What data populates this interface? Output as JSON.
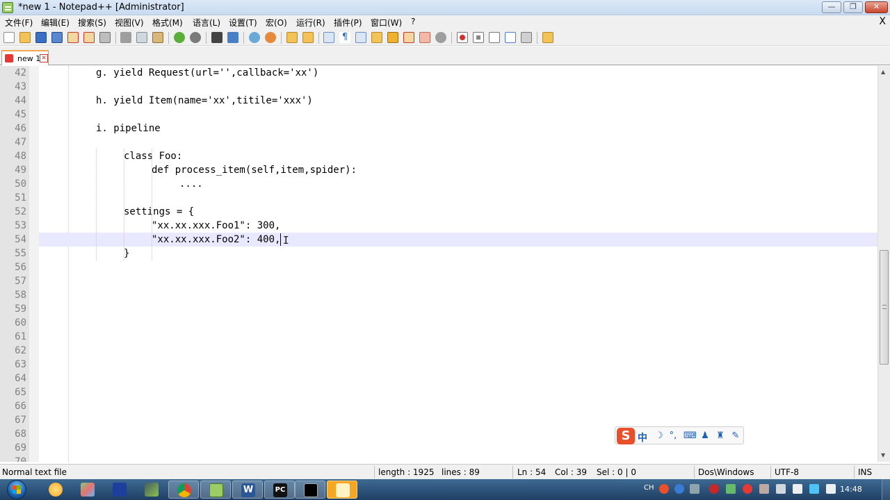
{
  "window": {
    "title": "*new 1 - Notepad++ [Administrator]",
    "minimize_glyph": "—",
    "restore_glyph": "❐",
    "close_glyph": "✕"
  },
  "menu": {
    "items": [
      "文件(F)",
      "编辑(E)",
      "搜索(S)",
      "视图(V)",
      "格式(M)",
      "语言(L)",
      "设置(T)",
      "宏(O)",
      "运行(R)",
      "插件(P)",
      "窗口(W)",
      "?"
    ],
    "close_doc": "X"
  },
  "toolbar": {
    "icons": [
      "new-file-icon",
      "open-file-icon",
      "save-icon",
      "save-all-icon",
      "close-icon",
      "close-all-icon",
      "print-icon",
      "cut-icon",
      "copy-icon",
      "paste-icon",
      "undo-icon",
      "redo-icon",
      "find-icon",
      "replace-icon",
      "zoom-in-icon",
      "zoom-out-icon",
      "sync-vertical-icon",
      "sync-horizontal-icon",
      "word-wrap-icon",
      "show-all-chars-icon",
      "indent-guide-icon",
      "user-lang-icon",
      "doc-map-icon",
      "function-list-icon",
      "folder-workspace-icon",
      "monitoring-icon",
      "record-macro-icon",
      "stop-record-icon",
      "play-macro-icon",
      "run-macro-multiple-icon",
      "save-macro-icon",
      "plugin-icon"
    ]
  },
  "tabs": [
    {
      "label": "new 1",
      "modified": true
    }
  ],
  "editor": {
    "lines": [
      {
        "num": "42",
        "indent": 2,
        "text": "g. yield Request(url='',callback='xx')"
      },
      {
        "num": "43",
        "indent": 0,
        "text": ""
      },
      {
        "num": "44",
        "indent": 2,
        "text": "h. yield Item(name='xx',titile='xxx')"
      },
      {
        "num": "45",
        "indent": 0,
        "text": ""
      },
      {
        "num": "46",
        "indent": 2,
        "text": "i. pipeline"
      },
      {
        "num": "47",
        "indent": 0,
        "text": ""
      },
      {
        "num": "48",
        "indent": 3,
        "text": "class Foo:"
      },
      {
        "num": "49",
        "indent": 4,
        "text": "def process_item(self,item,spider):"
      },
      {
        "num": "50",
        "indent": 5,
        "text": "...."
      },
      {
        "num": "51",
        "indent": 0,
        "text": ""
      },
      {
        "num": "52",
        "indent": 3,
        "text": "settings = {"
      },
      {
        "num": "53",
        "indent": 4,
        "text": "\"xx.xx.xxx.Foo1\": 300,"
      },
      {
        "num": "54",
        "indent": 4,
        "text": "\"xx.xx.xxx.Foo2\": 400,"
      },
      {
        "num": "55",
        "indent": 3,
        "text": "}"
      },
      {
        "num": "56",
        "indent": 0,
        "text": ""
      },
      {
        "num": "57",
        "indent": 0,
        "text": ""
      },
      {
        "num": "58",
        "indent": 0,
        "text": ""
      },
      {
        "num": "59",
        "indent": 0,
        "text": ""
      },
      {
        "num": "60",
        "indent": 0,
        "text": ""
      },
      {
        "num": "61",
        "indent": 0,
        "text": ""
      },
      {
        "num": "62",
        "indent": 0,
        "text": ""
      },
      {
        "num": "63",
        "indent": 0,
        "text": ""
      },
      {
        "num": "64",
        "indent": 0,
        "text": ""
      },
      {
        "num": "65",
        "indent": 0,
        "text": ""
      },
      {
        "num": "66",
        "indent": 0,
        "text": ""
      },
      {
        "num": "67",
        "indent": 0,
        "text": ""
      },
      {
        "num": "68",
        "indent": 0,
        "text": ""
      },
      {
        "num": "69",
        "indent": 0,
        "text": ""
      },
      {
        "num": "70",
        "indent": 0,
        "text": ""
      }
    ],
    "current_line": "54",
    "caret_col": 39
  },
  "ime": {
    "logo": "S",
    "lang": "中",
    "icons": [
      {
        "name": "moon-icon",
        "glyph": "☽"
      },
      {
        "name": "punctuation-icon",
        "glyph": "°,"
      },
      {
        "name": "keyboard-icon",
        "glyph": "⌨"
      },
      {
        "name": "user-icon",
        "glyph": "♟"
      },
      {
        "name": "skin-icon",
        "glyph": "♜"
      },
      {
        "name": "wrench-icon",
        "glyph": "✎"
      }
    ]
  },
  "statusbar": {
    "file_type": "Normal text file",
    "length": "length : 1925",
    "lines": "lines : 89",
    "ln": "Ln : 54",
    "col": "Col : 39",
    "sel": "Sel : 0 | 0",
    "eol": "Dos\\Windows",
    "encoding": "UTF-8",
    "mode": "INS"
  },
  "taskbar": {
    "apps": [
      "paint-icon",
      "network-icon",
      "save-disk-icon",
      "tools-icon",
      "chrome-icon",
      "notepadpp-icon",
      "word-icon",
      "pycharm-icon",
      "cmd-icon",
      "sticky-icon"
    ],
    "tray_lang": "CH",
    "clock": "14:48"
  },
  "colors": {
    "current_line": "#e8e8ff",
    "gutter": "#e4e4e4",
    "line_number": "#808080",
    "tab_accent": "#f2a650"
  }
}
